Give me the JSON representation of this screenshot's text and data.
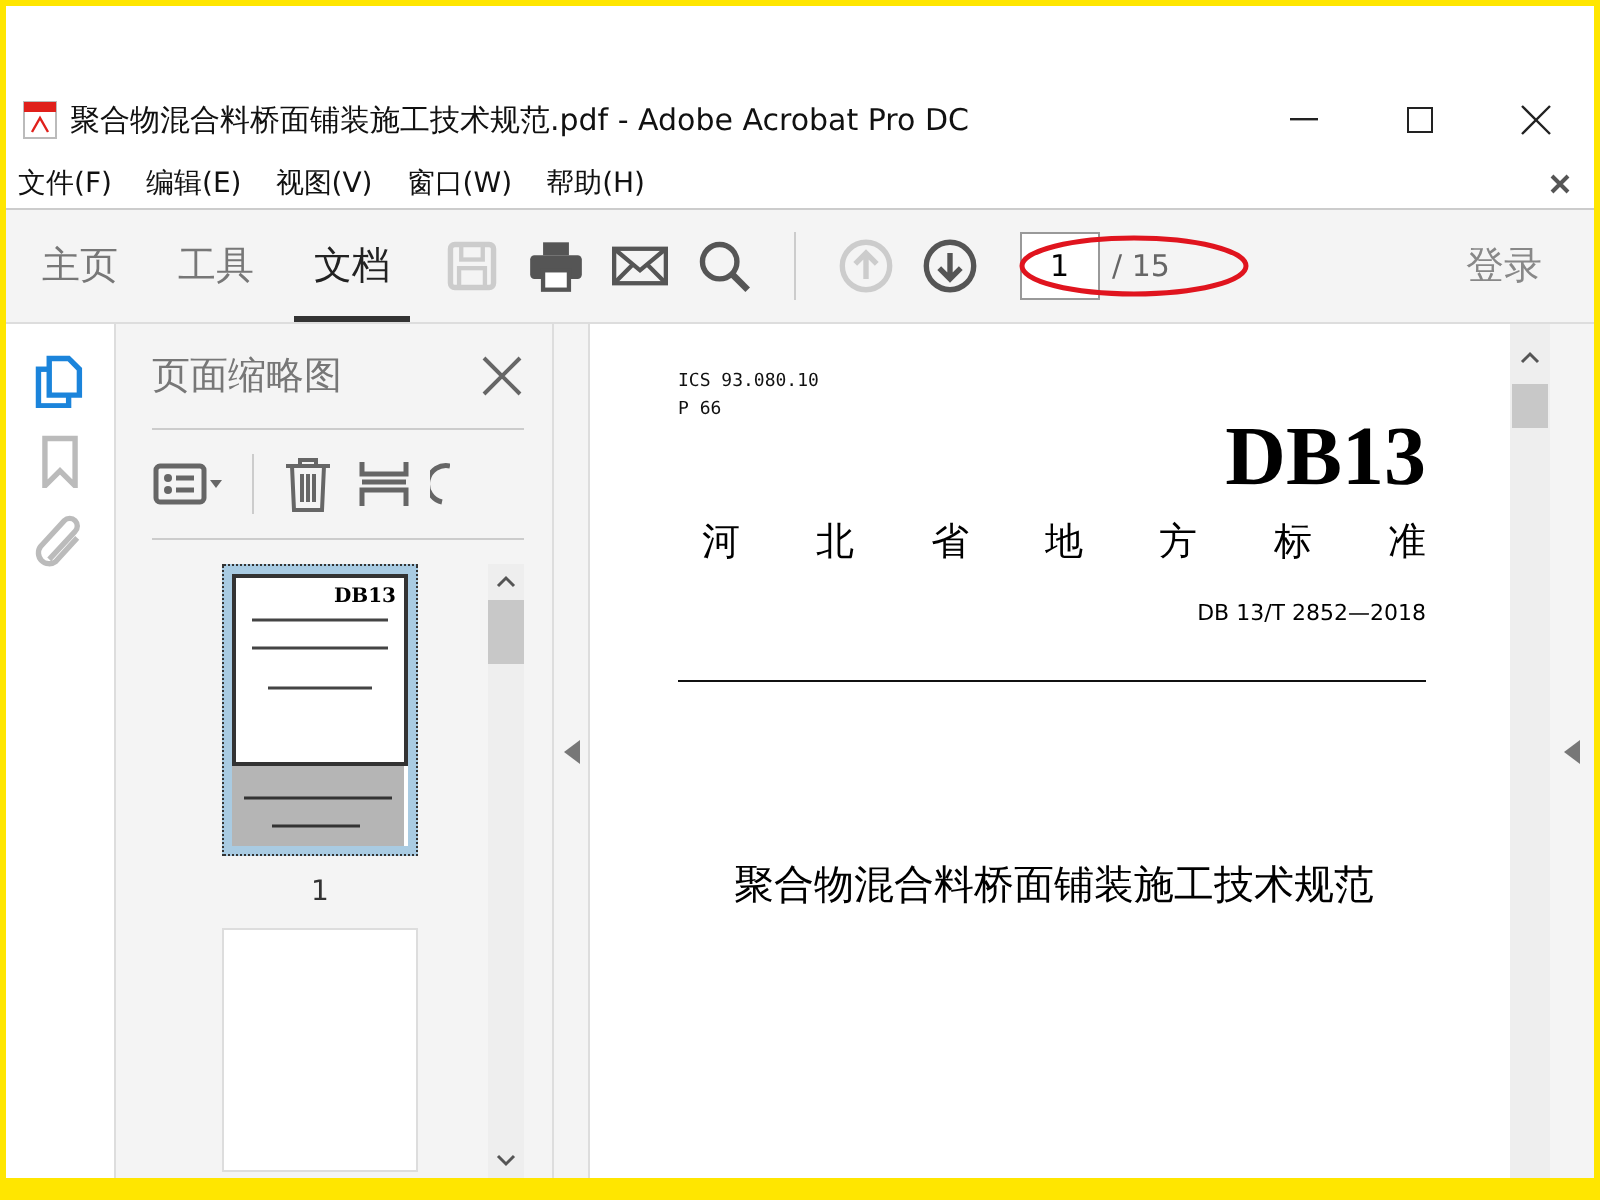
{
  "window": {
    "title": "聚合物混合料桥面铺装施工技术规范.pdf - Adobe Acrobat Pro DC"
  },
  "menu": [
    {
      "label": "文件(F)"
    },
    {
      "label": "编辑(E)"
    },
    {
      "label": "视图(V)"
    },
    {
      "label": "窗口(W)"
    },
    {
      "label": "帮助(H)"
    }
  ],
  "toolbar": {
    "tabs": [
      {
        "label": "主页",
        "selected": false
      },
      {
        "label": "工具",
        "selected": false
      },
      {
        "label": "文档",
        "selected": true
      }
    ],
    "tools": [
      {
        "kind": "save",
        "disabled": true
      },
      {
        "kind": "print",
        "disabled": false
      },
      {
        "kind": "mail",
        "disabled": false
      },
      {
        "kind": "search",
        "disabled": false
      }
    ],
    "nav": [
      {
        "kind": "up",
        "disabled": true
      },
      {
        "kind": "down",
        "disabled": false
      }
    ],
    "page_number": "1",
    "page_total": "/ 15",
    "sign_in": "登录"
  },
  "side_rail": [
    {
      "kind": "pages",
      "selected": true
    },
    {
      "kind": "bookmarks",
      "selected": false
    },
    {
      "kind": "attachments",
      "selected": false
    }
  ],
  "panel": {
    "title": "页面缩略图",
    "thumbnails": [
      {
        "selected": true,
        "title": "DB13",
        "label": "1"
      },
      {
        "selected": false
      }
    ]
  },
  "document": {
    "ics": "ICS  93.080.10",
    "class": "P 66",
    "code": "DB13",
    "region": "河 北 省 地 方 标 准",
    "number": "DB 13/T 2852—2018",
    "title": "聚合物混合料桥面铺装施工技术规范"
  }
}
